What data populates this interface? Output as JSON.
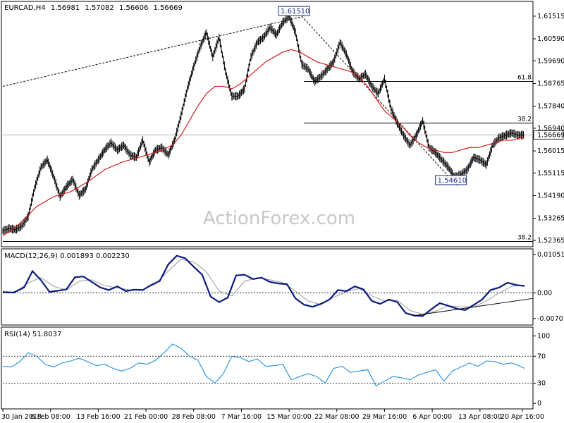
{
  "chart_data": [
    {
      "panel": "price",
      "type": "line",
      "title": "EURCAD,H4",
      "ohlc": [
        "1.56981",
        "1.57082",
        "1.56606",
        "1.56669"
      ],
      "y_ticks": [
        "1.61515",
        "1.60590",
        "1.59690",
        "1.58765",
        "1.57840",
        "1.56940",
        "1.56015",
        "1.55115",
        "1.54190",
        "1.53265",
        "1.52365"
      ],
      "y_tick_values": [
        1.61515,
        1.6059,
        1.5969,
        1.58765,
        1.5784,
        1.5694,
        1.56015,
        1.55115,
        1.5419,
        1.53265,
        1.52365
      ],
      "ylim": [
        1.5219,
        1.6203
      ],
      "last_price": "1.56669",
      "last_price_value": 1.56669,
      "series": [
        {
          "name": "",
          "kind": "price",
          "color": "#000000",
          "x": [
            0,
            3,
            6,
            9,
            12,
            15,
            18,
            21,
            24,
            27,
            30,
            33,
            36,
            39,
            42,
            45,
            48,
            51,
            54,
            57,
            60,
            63,
            66,
            69,
            72,
            75,
            78,
            81,
            84,
            87,
            90,
            93,
            96,
            99,
            102,
            105,
            108,
            111,
            114,
            117,
            120,
            123,
            126,
            129,
            132,
            135,
            138,
            141,
            144,
            147,
            150,
            153,
            156,
            159,
            162,
            165,
            168,
            171,
            174,
            177,
            180,
            183,
            186,
            189,
            192,
            195,
            198,
            201,
            204,
            207,
            210,
            213,
            216,
            219,
            222,
            225,
            228,
            231,
            234,
            237,
            240,
            243,
            246
          ],
          "values": [
            1.5275,
            1.5285,
            1.528,
            1.5295,
            1.5335,
            1.545,
            1.5535,
            1.5565,
            1.5495,
            1.5415,
            1.5455,
            1.5485,
            1.542,
            1.5445,
            1.5525,
            1.5565,
            1.5605,
            1.5635,
            1.5605,
            1.5625,
            1.5585,
            1.5575,
            1.5645,
            1.5555,
            1.5605,
            1.5615,
            1.5585,
            1.5645,
            1.5745,
            1.5855,
            1.5945,
            1.6025,
            1.6085,
            1.5985,
            1.6065,
            1.5925,
            1.5825,
            1.5825,
            1.5855,
            1.5985,
            1.6045,
            1.6065,
            1.6105,
            1.6075,
            1.6125,
            1.6151,
            1.6085,
            1.5955,
            1.5935,
            1.5885,
            1.5905,
            1.5935,
            1.5965,
            1.6045,
            1.5995,
            1.5925,
            1.5895,
            1.5915,
            1.5865,
            1.5835,
            1.5895,
            1.5775,
            1.5715,
            1.5665,
            1.5625,
            1.5665,
            1.5725,
            1.5615,
            1.5595,
            1.5565,
            1.5535,
            1.5495,
            1.5505,
            1.5525,
            1.5575,
            1.5565,
            1.5545,
            1.5625,
            1.5655,
            1.5665,
            1.5675,
            1.5665,
            1.5667
          ]
        },
        {
          "name": "",
          "kind": "ma",
          "color": "#d81c1c",
          "x": [
            0,
            8,
            16,
            24,
            32,
            40,
            48,
            56,
            64,
            72,
            80,
            84,
            88,
            92,
            96,
            100,
            104,
            108,
            112,
            116,
            120,
            124,
            128,
            132,
            136,
            140,
            144,
            148,
            152,
            156,
            160,
            164,
            168,
            172,
            176,
            180,
            184,
            188,
            192,
            196,
            200,
            204,
            208,
            212,
            216,
            220,
            224,
            228,
            232,
            236,
            240,
            244,
            246
          ],
          "values": [
            1.5255,
            1.5305,
            1.5375,
            1.5415,
            1.5435,
            1.5475,
            1.5525,
            1.5555,
            1.5575,
            1.5595,
            1.5625,
            1.5665,
            1.5725,
            1.5785,
            1.5835,
            1.5865,
            1.5865,
            1.5855,
            1.5875,
            1.5905,
            1.5935,
            1.5965,
            1.5985,
            1.6005,
            1.6015,
            1.6005,
            1.5985,
            1.5965,
            1.5955,
            1.5945,
            1.5935,
            1.5925,
            1.5905,
            1.5865,
            1.5815,
            1.5765,
            1.5735,
            1.5705,
            1.5665,
            1.5635,
            1.5615,
            1.5605,
            1.5595,
            1.5595,
            1.5605,
            1.5615,
            1.5615,
            1.5625,
            1.5635,
            1.5645,
            1.5645,
            1.5655,
            1.5655
          ]
        }
      ],
      "trendlines": [
        {
          "style": "dotted",
          "x": [
            0,
            141
          ],
          "values": [
            1.5865,
            1.6149
          ]
        },
        {
          "style": "dotted",
          "x": [
            141,
            214
          ],
          "values": [
            1.6151,
            1.5461
          ]
        }
      ],
      "fib_levels": [
        {
          "label": "61.8",
          "value": 1.5885,
          "x": [
            142,
            246
          ]
        },
        {
          "label": "38.2",
          "value": 1.5715,
          "x": [
            142,
            246
          ]
        },
        {
          "label": "38.2",
          "value": 1.5232,
          "x": [
            0,
            246
          ]
        }
      ],
      "callouts": [
        {
          "text": "1.61510",
          "x": 130,
          "value": 1.6171,
          "anchor_x": 141,
          "anchor_value": 1.6151
        },
        {
          "text": "1.54610",
          "x": 204,
          "value": 1.5481,
          "anchor_x": 214,
          "anchor_value": 1.5461
        }
      ],
      "x_count": 246
    },
    {
      "panel": "macd",
      "type": "line",
      "title": "MACD(12,26,9) 0.001893 0.002230",
      "y_ticks": [
        "0.010511",
        "0.00",
        "-0.007014"
      ],
      "y_tick_values": [
        0.010511,
        0.0,
        -0.007014
      ],
      "ylim": [
        -0.0082,
        0.0115
      ],
      "zero_line": 0.0,
      "series": [
        {
          "name": "",
          "kind": "main",
          "color": "#0b1a80",
          "x": [
            0,
            5,
            10,
            14,
            18,
            22,
            26,
            30,
            34,
            38,
            42,
            46,
            50,
            54,
            58,
            62,
            66,
            70,
            74,
            78,
            82,
            86,
            90,
            94,
            98,
            102,
            106,
            110,
            114,
            118,
            122,
            126,
            130,
            134,
            138,
            142,
            146,
            150,
            154,
            158,
            162,
            166,
            170,
            174,
            178,
            182,
            186,
            190,
            194,
            198,
            202,
            206,
            210,
            214,
            218,
            222,
            226,
            230,
            234,
            238,
            242,
            246
          ],
          "values": [
            0.0002,
            0.0001,
            0.0015,
            0.006,
            0.0035,
            0.0003,
            0.0006,
            0.001,
            0.0043,
            0.0045,
            0.003,
            0.0015,
            0.0008,
            0.0018,
            0.0005,
            0.0009,
            0.0008,
            0.0022,
            0.0033,
            0.0078,
            0.0102,
            0.0095,
            0.0072,
            0.005,
            -0.001,
            -0.0025,
            -0.0013,
            0.0048,
            0.005,
            0.0038,
            0.0042,
            0.003,
            0.0026,
            0.0024,
            -0.0015,
            -0.0032,
            -0.0038,
            -0.003,
            -0.0018,
            0.0008,
            0.0005,
            0.0018,
            0.001,
            -0.0022,
            -0.003,
            -0.0018,
            -0.0025,
            -0.0055,
            -0.0062,
            -0.0063,
            -0.0045,
            -0.0028,
            -0.0035,
            -0.0043,
            -0.0047,
            -0.0033,
            -0.0018,
            0.0008,
            0.0015,
            0.0028,
            0.0022,
            0.0019
          ]
        },
        {
          "name": "",
          "kind": "signal",
          "color": "#9a9a9a",
          "x": [
            0,
            6,
            12,
            18,
            24,
            30,
            36,
            42,
            48,
            54,
            60,
            66,
            72,
            78,
            84,
            90,
            96,
            102,
            108,
            114,
            120,
            126,
            132,
            138,
            144,
            150,
            156,
            162,
            168,
            174,
            180,
            186,
            192,
            198,
            204,
            210,
            216,
            222,
            228,
            234,
            240,
            246
          ],
          "values": [
            0.0004,
            0.0002,
            0.0028,
            0.0042,
            0.0018,
            0.0008,
            0.0032,
            0.0036,
            0.002,
            0.0014,
            0.0008,
            0.0009,
            0.0025,
            0.006,
            0.0092,
            0.0085,
            0.0058,
            0.0005,
            -0.0008,
            0.0032,
            0.0042,
            0.0036,
            0.0028,
            0.0005,
            -0.0022,
            -0.0032,
            -0.0012,
            0.0004,
            0.0012,
            -0.0008,
            -0.0022,
            -0.002,
            -0.0048,
            -0.0058,
            -0.005,
            -0.0035,
            -0.0038,
            -0.0038,
            -0.0022,
            0.0,
            0.0018,
            0.0022
          ]
        }
      ],
      "trendlines": [
        {
          "style": "solid",
          "x": [
            194,
            246
          ],
          "values": [
            -0.0062,
            -0.0015
          ]
        }
      ],
      "x_count": 246
    },
    {
      "panel": "rsi",
      "type": "line",
      "title": "RSI(14) 51.8037",
      "y_ticks": [
        "100",
        "70",
        "30",
        "0"
      ],
      "y_tick_values": [
        100,
        70,
        30,
        0
      ],
      "ylim": [
        -5,
        110
      ],
      "dotted_levels": [
        70,
        30
      ],
      "series": [
        {
          "name": "",
          "kind": "rsi",
          "color": "#1f8fe0",
          "x": [
            0,
            4,
            8,
            12,
            16,
            20,
            24,
            28,
            32,
            36,
            40,
            44,
            48,
            52,
            56,
            60,
            64,
            68,
            72,
            76,
            80,
            84,
            88,
            92,
            96,
            100,
            104,
            108,
            112,
            116,
            120,
            124,
            128,
            132,
            136,
            140,
            144,
            148,
            152,
            156,
            160,
            164,
            168,
            172,
            176,
            180,
            184,
            188,
            192,
            196,
            200,
            204,
            208,
            212,
            216,
            220,
            224,
            228,
            232,
            236,
            240,
            244,
            246
          ],
          "values": [
            55,
            54,
            62,
            75,
            70,
            58,
            54,
            60,
            63,
            67,
            62,
            56,
            58,
            52,
            48,
            52,
            60,
            58,
            64,
            75,
            88,
            82,
            70,
            64,
            40,
            30,
            44,
            70,
            68,
            62,
            66,
            55,
            56,
            58,
            35,
            40,
            44,
            40,
            30,
            52,
            55,
            46,
            48,
            50,
            26,
            33,
            40,
            38,
            35,
            42,
            46,
            50,
            33,
            48,
            54,
            60,
            55,
            63,
            62,
            58,
            60,
            55,
            52
          ]
        }
      ],
      "x_count": 246
    }
  ],
  "x_axis": {
    "labels": [
      "30 Jan 2018",
      "6 Feb 08:00",
      "13 Feb 16:00",
      "21 Feb 00:00",
      "28 Feb 08:00",
      "7 Mar 16:00",
      "15 Mar 00:00",
      "22 Mar 08:00",
      "29 Mar 16:00",
      "6 Apr 00:00",
      "13 Apr 08:00",
      "20 Apr 16:00"
    ],
    "label_x": [
      0,
      22.5,
      45,
      67.5,
      90,
      112.5,
      135,
      157.5,
      180,
      202.5,
      225,
      245
    ]
  },
  "watermark": "ActionForex.com",
  "colors": {
    "price": "#000000",
    "ma": "#d81c1c",
    "macd": "#0b1a80",
    "signal": "#9a9a9a",
    "rsi": "#1f8fe0",
    "callout_text": "#1f2a8a",
    "grid_border": "#000000",
    "background": "#ffffff"
  }
}
